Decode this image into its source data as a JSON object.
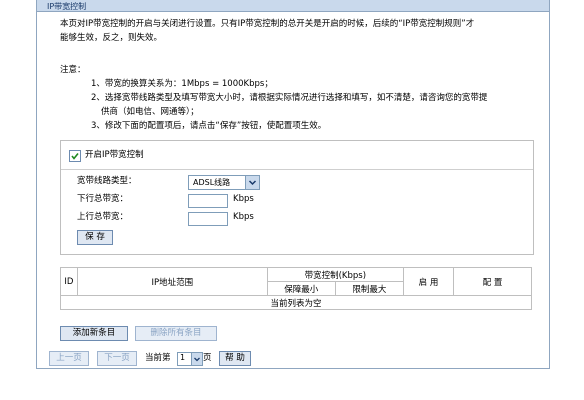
{
  "page": {
    "title": "IP带宽控制"
  },
  "intro": {
    "line1": "本页对IP带宽控制的开启与关闭进行设置。只有IP带宽控制的总开关是开启的时候，后续的“IP带宽控制规则”才",
    "line2": "能够生效，反之，则失效。"
  },
  "notes": {
    "heading": "注意：",
    "items": [
      "1、带宽的换算关系为：1Mbps = 1000Kbps；",
      "2、选择宽带线路类型及填写带宽大小时，请根据实际情况进行选择和填写，如不清楚，请咨询您的宽带提",
      "供商（如电信、网通等）；",
      "3、修改下面的配置项后，请点击“保存”按钮，使配置项生效。"
    ]
  },
  "settings": {
    "enable_label": "开启IP带宽控制",
    "enable_checked": true,
    "line_type_label": "宽带线路类型：",
    "line_type_value": "ADSL线路",
    "down_label": "下行总带宽：",
    "down_value": "",
    "up_label": "上行总带宽：",
    "up_value": "",
    "unit": "Kbps",
    "save_button": "保 存"
  },
  "rules_table": {
    "col_id": "ID",
    "col_ip_range": "IP地址范围",
    "col_bandwidth": "带宽控制(Kbps)",
    "col_min": "保障最小",
    "col_max": "限制最大",
    "col_enable": "启 用",
    "col_config": "配 置",
    "empty_text": "当前列表为空"
  },
  "actions": {
    "add_button": "添加新条目",
    "delete_all_button": "删除所有条目"
  },
  "pager": {
    "prev_button": "上一页",
    "next_button": "下一页",
    "current_prefix": "当前第",
    "page_value": "1",
    "page_suffix": "页",
    "help_button": "帮 助"
  }
}
